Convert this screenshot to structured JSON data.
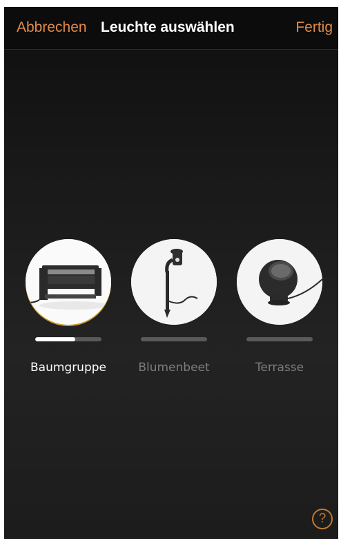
{
  "header": {
    "cancel_label": "Abbrechen",
    "title": "Leuchte auswählen",
    "done_label": "Fertig"
  },
  "colors": {
    "accent": "#e08a4a",
    "background": "#1a1a1a",
    "progress_track": "#5a5a5a",
    "progress_fill": "#ffffff",
    "selected_ring": "#d39a2a"
  },
  "lamps": [
    {
      "label": "Baumgruppe",
      "icon": "spot-light-box-icon",
      "selected": true,
      "progress": 0.6
    },
    {
      "label": "Blumenbeet",
      "icon": "stake-light-icon",
      "selected": false,
      "progress": 0
    },
    {
      "label": "Terrasse",
      "icon": "sphere-light-icon",
      "selected": false,
      "progress": 0
    }
  ],
  "help": {
    "symbol": "?",
    "icon": "help-icon"
  }
}
